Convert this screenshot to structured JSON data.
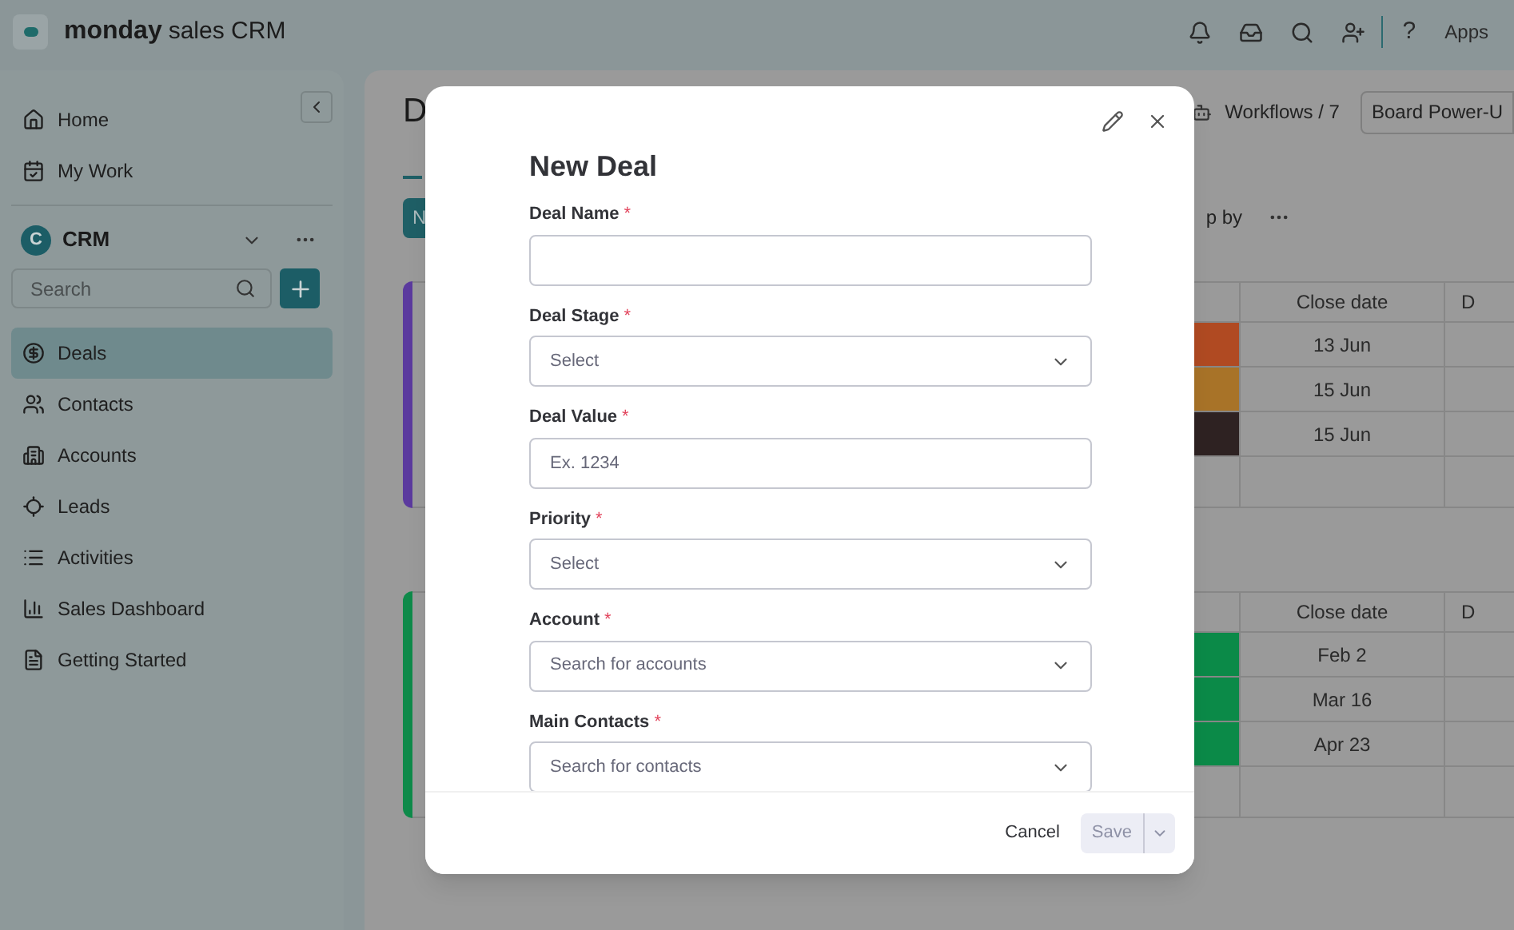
{
  "app_header": {
    "brand": "monday",
    "product": "sales CRM",
    "apps_label": "Apps",
    "help_label": "?"
  },
  "sidebar": {
    "nav": [
      {
        "label": "Home"
      },
      {
        "label": "My Work"
      }
    ],
    "workspace": {
      "initial": "C",
      "name": "CRM"
    },
    "search": {
      "placeholder": "Search"
    },
    "items": [
      {
        "label": "Deals",
        "selected": true
      },
      {
        "label": "Contacts",
        "selected": false
      },
      {
        "label": "Accounts",
        "selected": false
      },
      {
        "label": "Leads",
        "selected": false
      },
      {
        "label": "Activities",
        "selected": false
      },
      {
        "label": "Sales Dashboard",
        "selected": false
      },
      {
        "label": "Getting Started",
        "selected": false
      }
    ]
  },
  "board": {
    "title": "D",
    "workflows": "Workflows / 7",
    "power_ups": "Board Power-U",
    "new_button": "N",
    "group_by": "p by",
    "groups": [
      {
        "color": "#5b3a9e",
        "columns": [
          "Close date",
          "D"
        ],
        "rows": [
          {
            "color": "#b04a22",
            "close_date": "13 Jun"
          },
          {
            "color": "#a87328",
            "close_date": "15 Jun"
          },
          {
            "color": "#2e2222",
            "close_date": "15 Jun"
          }
        ]
      },
      {
        "color": "#0e8a4a",
        "columns": [
          "Close date",
          "D"
        ],
        "rows": [
          {
            "color": "#0b8a48",
            "close_date": "Feb 2"
          },
          {
            "color": "#0b8a48",
            "close_date": "Mar 16"
          },
          {
            "color": "#0b8a48",
            "close_date": "Apr 23"
          }
        ]
      }
    ]
  },
  "modal": {
    "title": "New Deal",
    "fields": [
      {
        "label": "Deal Name",
        "required_mark": "*",
        "kind": "text"
      },
      {
        "label": "Deal Stage",
        "required_mark": "*",
        "kind": "select",
        "placeholder": "Select"
      },
      {
        "label": "Deal Value",
        "required_mark": "*",
        "kind": "text",
        "placeholder": "Ex. 1234"
      },
      {
        "label": "Priority",
        "required_mark": "*",
        "kind": "select",
        "placeholder": "Select"
      },
      {
        "label": "Account",
        "required_mark": "*",
        "kind": "select",
        "placeholder": "Search for accounts"
      },
      {
        "label": "Main Contacts",
        "required_mark": "*",
        "kind": "select",
        "placeholder": "Search for contacts"
      }
    ],
    "cancel": "Cancel",
    "save": "Save",
    "save_disabled": true
  }
}
